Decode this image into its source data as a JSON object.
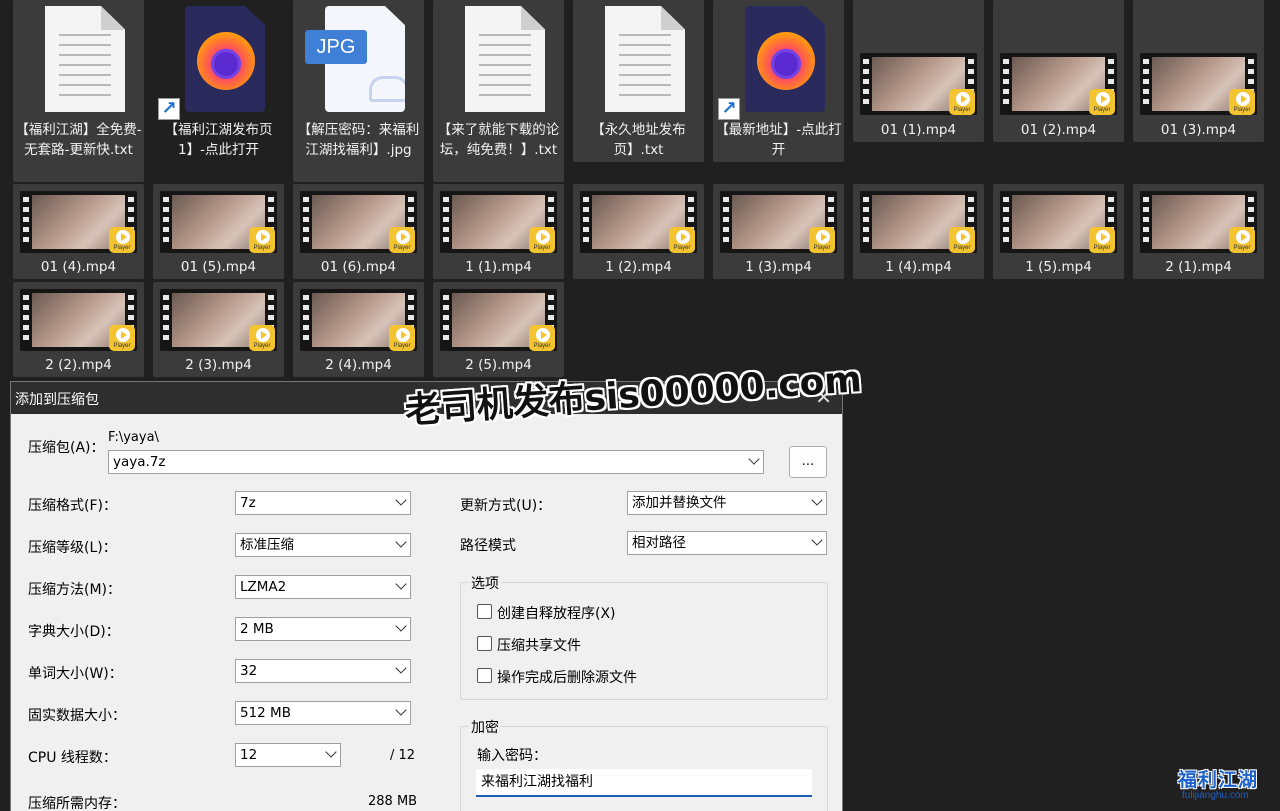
{
  "files": {
    "row0": [
      {
        "name": "【福利江湖】全免费-无套路-更新快.txt",
        "icon": "text-document-icon"
      },
      {
        "name": "【福利江湖发布页1】-点此打开",
        "icon": "firefox-shortcut-icon"
      },
      {
        "name": "【解压密码：来福利江湖找福利】.jpg",
        "icon": "jpg-file-icon",
        "badge": "JPG"
      },
      {
        "name": "【来了就能下载的论坛，纯免费！】.txt",
        "icon": "text-document-icon"
      },
      {
        "name": "【永久地址发布页】.txt",
        "icon": "text-document-icon"
      },
      {
        "name": "【最新地址】-点此打开",
        "icon": "firefox-shortcut-icon"
      },
      {
        "name": "01 (1).mp4",
        "icon": "video-thumbnail"
      },
      {
        "name": "01 (2).mp4",
        "icon": "video-thumbnail"
      },
      {
        "name": "01 (3).mp4",
        "icon": "video-thumbnail"
      }
    ],
    "row1": [
      "01 (4).mp4",
      "01 (5).mp4",
      "01 (6).mp4",
      "1 (1).mp4",
      "1 (2).mp4",
      "1 (3).mp4",
      "1 (4).mp4",
      "1 (5).mp4",
      "2 (1).mp4"
    ],
    "row2": [
      "2 (2).mp4",
      "2 (3).mp4",
      "2 (4).mp4",
      "2 (5).mp4"
    ],
    "player_badge": "Player",
    "shortcut_glyph": "↗"
  },
  "dialog": {
    "title": "添加到压缩包",
    "close_glyph": "✕",
    "archive_label": "压缩包(A)：",
    "archive_path": "F:\\yaya\\",
    "archive_name": "yaya.7z",
    "browse_label": "...",
    "left_fields": [
      {
        "label": "压缩格式(F)：",
        "value": "7z"
      },
      {
        "label": "压缩等级(L)：",
        "value": "标准压缩"
      },
      {
        "label": "压缩方法(M)：",
        "value": "LZMA2"
      },
      {
        "label": "字典大小(D)：",
        "value": "2 MB"
      },
      {
        "label": "单词大小(W)：",
        "value": "32"
      },
      {
        "label": "固实数据大小：",
        "value": "512 MB"
      }
    ],
    "cpu_label": "CPU 线程数：",
    "cpu_value": "12",
    "cpu_total": "/ 12",
    "memory_label": "压缩所需内存：",
    "memory_value": "288 MB",
    "update_label": "更新方式(U)：",
    "update_value": "添加并替换文件",
    "path_label": "路径模式",
    "path_value": "相对路径",
    "options_title": "选项",
    "options": [
      {
        "label": "创建自释放程序(X)",
        "checked": false
      },
      {
        "label": "压缩共享文件",
        "checked": false
      },
      {
        "label": "操作完成后删除源文件",
        "checked": false
      }
    ],
    "encrypt_title": "加密",
    "password_label": "输入密码：",
    "password_value": "来福利江湖找福利"
  },
  "watermark": {
    "text": "老司机发布sis00000.com",
    "logo_text": "福利江湖",
    "logo_sub": "fulijianghu.com"
  },
  "colors": {
    "desktop_bg": "#202020",
    "tile_bg": "#3b3b3b",
    "dialog_bg": "#f0f0f0",
    "titlebar_bg": "#2e2e2e",
    "accent": "#1a5fb4",
    "player_yellow": "#f4c430"
  }
}
